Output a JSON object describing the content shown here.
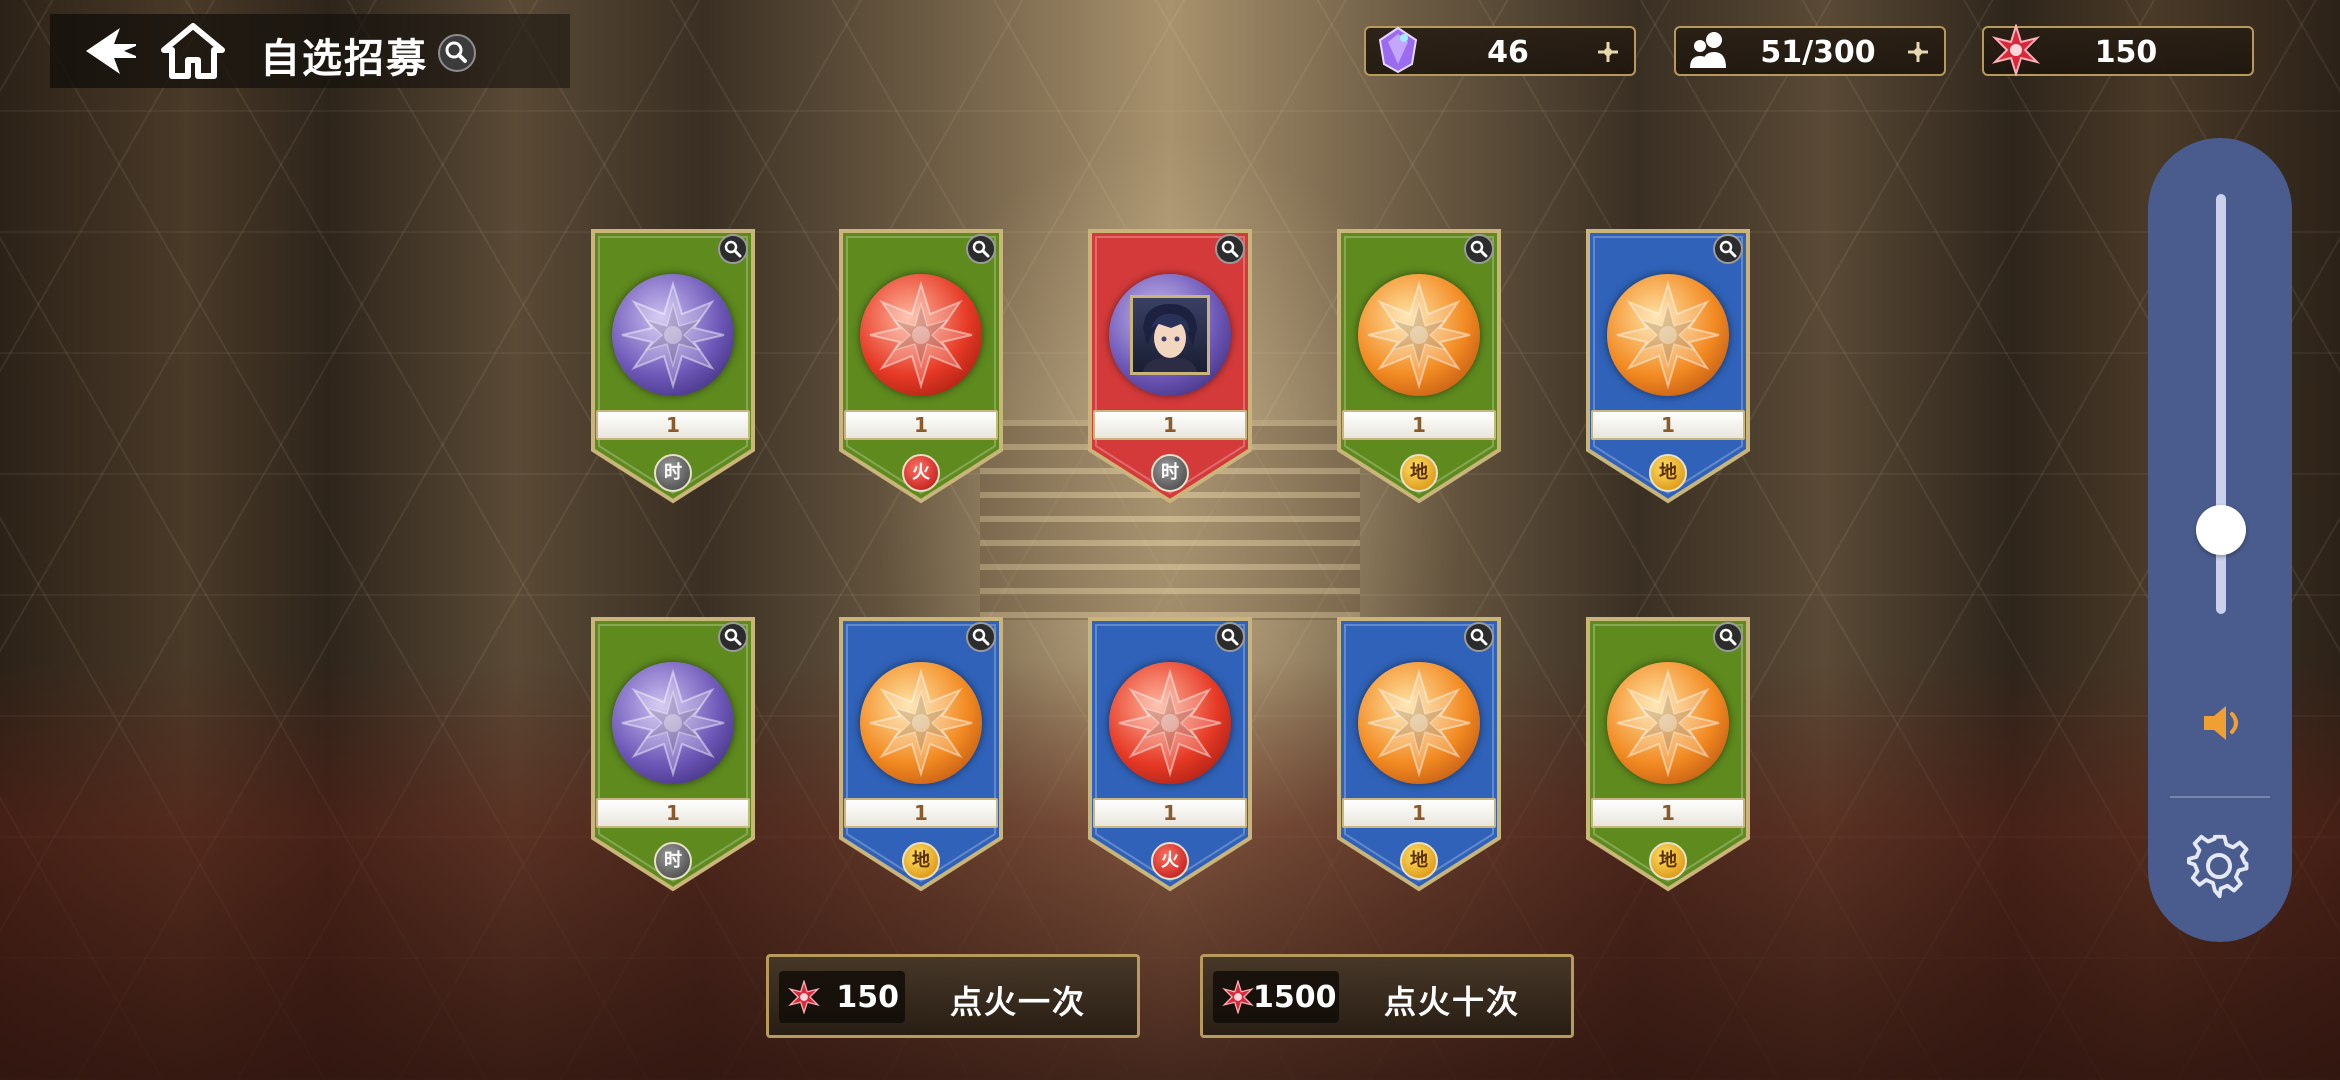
{
  "header": {
    "title": "自选招募"
  },
  "resources": [
    {
      "name": "gem",
      "value": "46"
    },
    {
      "name": "roster",
      "value": "51/300"
    },
    {
      "name": "summon-crystal",
      "value": "150"
    }
  ],
  "cards_row1": [
    {
      "banner": "green",
      "orb": "purple",
      "count": "1",
      "element": "时",
      "element_type": "time"
    },
    {
      "banner": "green",
      "orb": "red",
      "count": "1",
      "element": "火",
      "element_type": "fire"
    },
    {
      "banner": "red",
      "orb": "portrait",
      "count": "1",
      "element": "时",
      "element_type": "time"
    },
    {
      "banner": "green",
      "orb": "orange",
      "count": "1",
      "element": "地",
      "element_type": "earth"
    },
    {
      "banner": "blue",
      "orb": "orange",
      "count": "1",
      "element": "地",
      "element_type": "earth"
    }
  ],
  "cards_row2": [
    {
      "banner": "green",
      "orb": "purple",
      "count": "1",
      "element": "时",
      "element_type": "time"
    },
    {
      "banner": "blue",
      "orb": "orange",
      "count": "1",
      "element": "地",
      "element_type": "earth"
    },
    {
      "banner": "blue",
      "orb": "red",
      "count": "1",
      "element": "火",
      "element_type": "fire"
    },
    {
      "banner": "blue",
      "orb": "orange",
      "count": "1",
      "element": "地",
      "element_type": "earth"
    },
    {
      "banner": "green",
      "orb": "orange",
      "count": "1",
      "element": "地",
      "element_type": "earth"
    }
  ],
  "actions": {
    "single": {
      "cost": "150",
      "label": "点火一次"
    },
    "ten": {
      "cost": "1500",
      "label": "点火十次"
    }
  },
  "side_panel": {
    "volume_level": 0.2
  },
  "colors": {
    "banner_green": "#5e8a1e",
    "banner_red": "#d43a3a",
    "banner_blue": "#2f62b8",
    "gold_border": "#c9b47a",
    "panel": "#4a5c8e",
    "volume_icon": "#f0a030"
  }
}
